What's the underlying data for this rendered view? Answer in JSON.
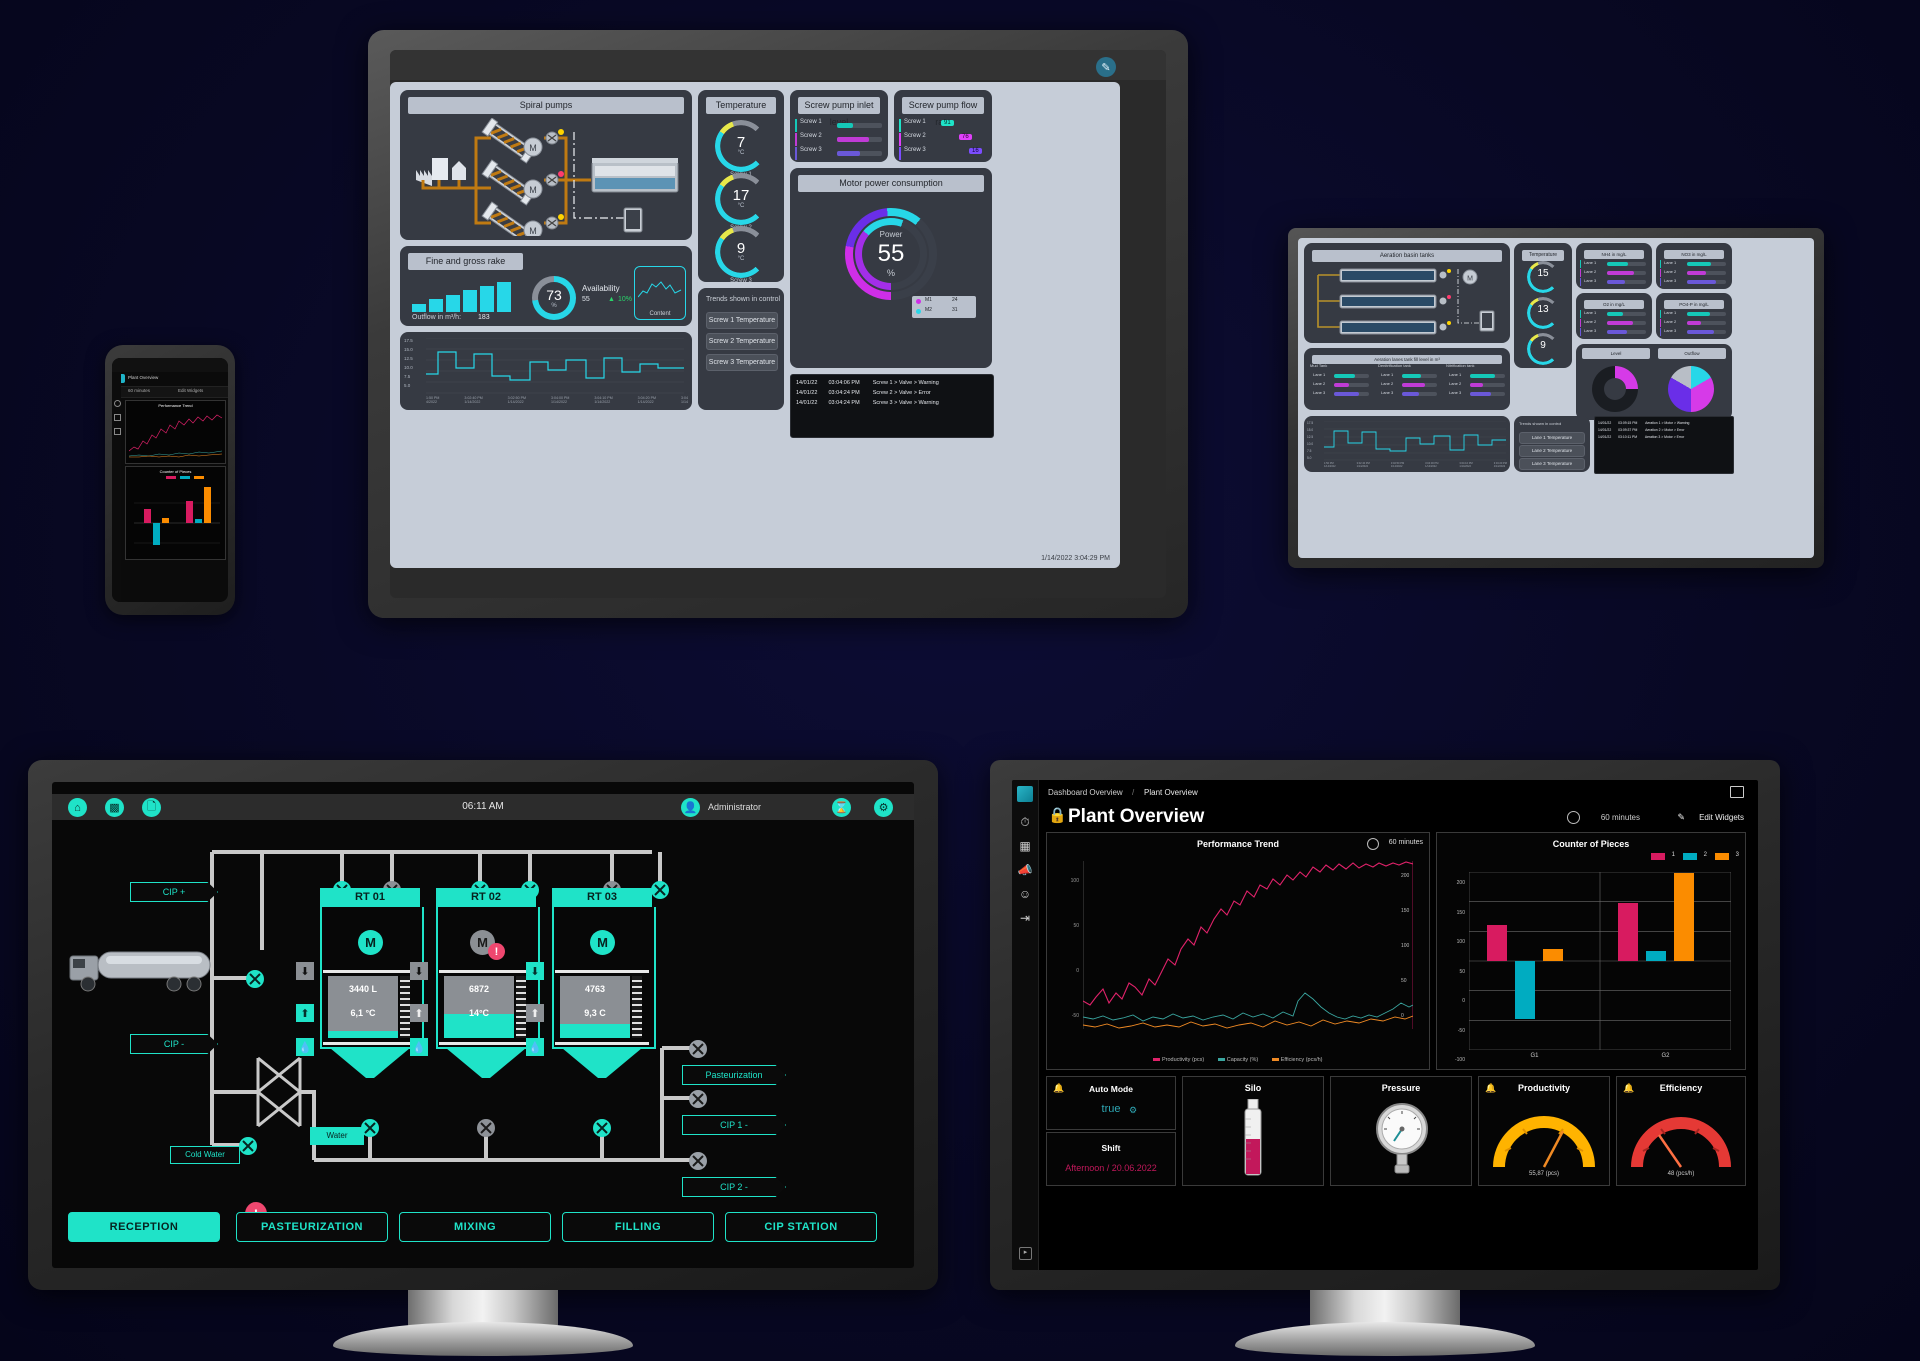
{
  "scene": {
    "background": "#0a0a2a",
    "devices": [
      "tablet-wwtp",
      "monitor-wwtp-small",
      "smartphone-dashboard",
      "monitor-dairy-cip",
      "monitor-plant-overview"
    ]
  },
  "wwtp_main": {
    "timestamp": "1/14/2022 3:04:29 PM",
    "edit_icon": "pencil-icon",
    "panels": {
      "spiral_pumps": {
        "title": "Spiral pumps",
        "motor_labels": [
          "M",
          "M",
          "M"
        ],
        "status_dots": [
          "#ffd400",
          "#ff3b6e",
          "#ffd400"
        ]
      },
      "fine_gross_rake": {
        "title": "Fine and gross rake",
        "outflow_label": "Outflow in m³/h:",
        "outflow_value": "183",
        "availability_value": "73",
        "availability_unit": "%",
        "availability_label": "Availability",
        "availability_sub": "55",
        "availability_delta": "10%",
        "content_label": "Content",
        "bars": [
          18,
          34,
          52,
          72,
          88,
          100
        ]
      },
      "temperature": {
        "title": "Temperature",
        "gauges": [
          {
            "value": "7",
            "unit": "°C",
            "caption": "Screw 1"
          },
          {
            "value": "17",
            "unit": "°C",
            "caption": "Screw 2"
          },
          {
            "value": "9",
            "unit": "°C",
            "caption": "Screw 3"
          }
        ]
      },
      "inlet_level": {
        "title": "Screw pump inlet level",
        "rows": [
          {
            "name": "Screw 1",
            "color": "#15c8b8",
            "pct": 35
          },
          {
            "name": "Screw 2",
            "color": "#c03bd6",
            "pct": 72
          },
          {
            "name": "Screw 3",
            "color": "#6a58d8",
            "pct": 50
          }
        ]
      },
      "flow_rate": {
        "title": "Screw pump flow rate",
        "rows": [
          {
            "name": "Screw 1",
            "color": "#1fe3c8",
            "value": "91"
          },
          {
            "name": "Screw 2",
            "color": "#e040fb",
            "value": "76"
          },
          {
            "name": "Screw 3",
            "color": "#7c4dff",
            "value": "16"
          }
        ]
      },
      "motor_power": {
        "title": "Motor power consumption",
        "label": "Power",
        "value": "55",
        "unit": "%",
        "legend": [
          {
            "name": "M1",
            "value": "24"
          },
          {
            "name": "M2",
            "value": "31"
          }
        ]
      },
      "trend": {
        "y_ticks": [
          "17.5",
          "15.0",
          "12.5",
          "10.0",
          "7.5",
          "5.0"
        ],
        "x_ticks": [
          "1:50 PM 1/14/2022",
          "3:02:40 PM 1/14/2022",
          "3:02:50 PM 1/14/2022",
          "3:04:00 PM 1/14/2022",
          "3:04:10 PM 1/14/2022",
          "3:04:20 PM 1/14/2022",
          "3:04:30 PM"
        ]
      },
      "trend_controls": {
        "title": "Trends shown in control",
        "buttons": [
          "Screw 1 Temperature",
          "Screw 2 Temperature",
          "Screw 3 Temperature"
        ]
      },
      "alarms": [
        {
          "date": "14/01/22",
          "time": "03:04:06 PM",
          "text": "Screw 1 > Valve > Warning"
        },
        {
          "date": "14/01/22",
          "time": "03:04:24 PM",
          "text": "Screw 2 > Valve > Error"
        },
        {
          "date": "14/01/22",
          "time": "03:04:24 PM",
          "text": "Screw 3 > Valve > Warning"
        }
      ]
    }
  },
  "wwtp_small": {
    "panels": {
      "aeration": {
        "title": "Aeration basin tanks",
        "motor": "M"
      },
      "temperature": {
        "title": "Temperature",
        "gauges": [
          {
            "value": "15",
            "caption": "Lane 1"
          },
          {
            "value": "13",
            "caption": "Lane 2"
          },
          {
            "value": "9",
            "caption": "Lane 3"
          }
        ]
      },
      "nh4": {
        "title": "NH4 in mg/L",
        "lanes": [
          "Lane 1",
          "Lane 2",
          "Lane 3"
        ]
      },
      "no3": {
        "title": "NO3 in mg/L",
        "lanes": [
          "Lane 1",
          "Lane 2",
          "Lane 3"
        ]
      },
      "o2": {
        "title": "O2 in mg/L",
        "lanes": [
          "Lane 1",
          "Lane 2",
          "Lane 3"
        ]
      },
      "po4": {
        "title": "PO4-P in mg/L",
        "lanes": [
          "Lane 1",
          "Lane 2",
          "Lane 3"
        ]
      },
      "level": {
        "title": "Level"
      },
      "outflow": {
        "title": "Outflow"
      },
      "slurry": {
        "title": "Aeration lanes tank fill level in m³",
        "groups": [
          "Mud Tank",
          "Denitrification tank",
          "Nitrification tank"
        ],
        "lanes": [
          "Lane 1",
          "Lane 2",
          "Lane 3"
        ]
      },
      "trend_controls": {
        "title": "Trends shown in control",
        "buttons": [
          "Lane 1 Temperature",
          "Lane 2 Temperature",
          "Lane 3 Temperature"
        ]
      },
      "alarms": [
        {
          "date": "14/01/22",
          "time": "03:09:15 PM",
          "text": "Aeration 1 > Motor > Warning"
        },
        {
          "date": "14/01/22",
          "time": "03:09:37 PM",
          "text": "Aeration 2 > Motor > Error"
        },
        {
          "date": "14/01/22",
          "time": "03:10:11 PM",
          "text": "Aeration 3 > Motor > Error"
        }
      ]
    }
  },
  "phone": {
    "title": "Plant Overview",
    "time_range": "60 minutes",
    "edit": "Edit Widgets",
    "chart1_title": "Performance Trend",
    "chart2_title": "Counter of Pieces"
  },
  "dairy": {
    "topbar": {
      "time": "06:11 AM",
      "user": "Administrator",
      "icons": [
        "home-icon",
        "chart-icon",
        "document-icon",
        "user-icon",
        "hourglass-icon",
        "gear-icon"
      ]
    },
    "flow_chips": {
      "cip_in": "CIP +",
      "cip_out": "CIP -",
      "cold_water": "Cold Water",
      "water": "Water",
      "pasteurization": "Pasteurization",
      "cip1": "CIP 1 -",
      "cip2": "CIP 2 -"
    },
    "tanks": [
      {
        "name": "RT 01",
        "volume": "3440 L",
        "temp": "6,1 °C",
        "motor": "M",
        "alarm": false,
        "fill_pct": 12
      },
      {
        "name": "RT 02",
        "volume": "6872",
        "temp": "14°C",
        "motor": "M",
        "alarm": true,
        "fill_pct": 38
      },
      {
        "name": "RT 03",
        "volume": "4763",
        "temp": "9,3 C",
        "motor": "M",
        "alarm": false,
        "fill_pct": 22
      }
    ],
    "nav_buttons": [
      {
        "label": "RECEPTION",
        "active": true,
        "alarm": true
      },
      {
        "label": "PASTEURIZATION",
        "active": false,
        "alarm": false
      },
      {
        "label": "MIXING",
        "active": false,
        "alarm": false
      },
      {
        "label": "FILLING",
        "active": false,
        "alarm": false
      },
      {
        "label": "CIP STATION",
        "active": false,
        "alarm": false
      }
    ]
  },
  "plant_overview": {
    "breadcrumb": [
      "Dashboard Overview",
      "Plant Overview"
    ],
    "breadcrumb_sep": "/",
    "page_title": "Plant Overview",
    "lock_icon": "lock-icon",
    "time_range": "60 minutes",
    "edit_widgets": "Edit Widgets",
    "rail_icons": [
      "logo-icon",
      "gauge-icon",
      "grid-icon",
      "megaphone-icon",
      "face-icon",
      "logout-icon"
    ],
    "expand_icon": "chevron-right-icon",
    "tiles": [
      {
        "name": "Auto Mode",
        "value": "true",
        "bell": true,
        "badge_icon": "settings-icon"
      },
      {
        "name": "Shift",
        "value": "Afternoon / 20.06.2022",
        "value_color": "#c2185b"
      },
      {
        "name": "Silo",
        "type": "silo-gauge"
      },
      {
        "name": "Pressure",
        "type": "analog-gauge"
      },
      {
        "name": "Productivity",
        "type": "arc-gauge",
        "value": "55,87 (pcs)",
        "color": "#ffb300",
        "bell": true
      },
      {
        "name": "Efficiency",
        "type": "arc-gauge",
        "value": "48 (pcs/h)",
        "color": "#e53935",
        "bell": true
      }
    ],
    "chart_data": [
      {
        "type": "line",
        "title": "Performance Trend",
        "time_range": "60 minutes",
        "xlabel": "",
        "ylabel": "",
        "ylim": [
          -50,
          100
        ],
        "y2lim": [
          0,
          200
        ],
        "y_ticks": [
          100,
          50,
          0,
          -50
        ],
        "y2_ticks": [
          200,
          150,
          100,
          50,
          0
        ],
        "grid": false,
        "legend_position": "bottom",
        "series": [
          {
            "name": "Productivity (pcs)",
            "color": "#e0226a",
            "values": [
              12,
              10,
              14,
              18,
              9,
              15,
              11,
              20,
              17,
              13,
              22,
              19,
              26,
              31,
              28,
              35,
              40,
              37,
              45,
              42,
              50,
              55,
              48,
              60,
              58,
              66,
              62,
              71,
              68,
              75,
              70,
              78,
              74,
              80,
              77,
              84,
              79,
              86,
              82,
              88,
              85,
              90,
              86,
              92,
              88,
              94,
              90,
              96,
              92,
              97
            ]
          },
          {
            "name": "Capacity (%)",
            "color": "#3aa6a0",
            "values": [
              -6,
              -8,
              -5,
              -9,
              -7,
              -4,
              -10,
              -6,
              -8,
              -3,
              -7,
              -5,
              -9,
              -6,
              -4,
              -8,
              -2,
              -6,
              -3,
              -7,
              -1,
              -5,
              -2,
              -6,
              -3,
              -8,
              -4,
              2,
              6,
              10,
              14,
              9,
              5,
              2,
              -2,
              -4,
              -6,
              -3,
              -5,
              -2,
              -4,
              -6,
              -3,
              -5,
              0,
              4,
              8,
              12,
              10,
              14
            ]
          },
          {
            "name": "Efficiency (pcs/h)",
            "color": "#f08a24",
            "values": [
              -18,
              -20,
              -17,
              -21,
              -19,
              -16,
              -22,
              -18,
              -20,
              -15,
              -19,
              -17,
              -21,
              -18,
              -16,
              -20,
              -14,
              -18,
              -15,
              -19,
              -13,
              -17,
              -14,
              -18,
              -15,
              -20,
              -16,
              -13,
              -15,
              -12,
              -14,
              -16,
              -13,
              -15,
              -12,
              -14,
              -11,
              -13,
              -10,
              -12,
              -9,
              -11,
              -8,
              -10,
              -6,
              -8,
              -5,
              -7,
              -4,
              -6
            ]
          }
        ]
      },
      {
        "type": "bar",
        "title": "Counter of Pieces",
        "categories": [
          "G1",
          "G2"
        ],
        "xlabel": "",
        "ylabel": "",
        "ylim": [
          -100,
          200
        ],
        "y_ticks": [
          200,
          150,
          100,
          50,
          0,
          -50,
          -100
        ],
        "grid": true,
        "legend_position": "top-right",
        "series": [
          {
            "name": "1",
            "color": "#d81b60",
            "values": [
              60,
              98
            ]
          },
          {
            "name": "2",
            "color": "#00acc1",
            "values": [
              -98,
              18
            ]
          },
          {
            "name": "3",
            "color": "#fb8c00",
            "values": [
              20,
              199
            ]
          }
        ]
      }
    ]
  }
}
